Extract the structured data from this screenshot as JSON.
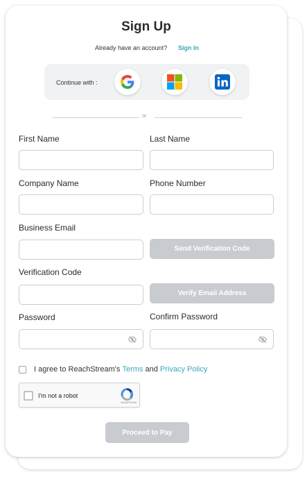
{
  "form": {
    "title": "Sign Up",
    "have_account_text": "Already have an account?",
    "sign_in_link": "Sign In",
    "continue_with_label": "Continue with :",
    "social": [
      "google-icon",
      "microsoft-icon",
      "linkedin-icon"
    ],
    "or_text": "or",
    "fields": {
      "first_name": {
        "label": "First Name",
        "value": "",
        "placeholder": ""
      },
      "last_name": {
        "label": "Last Name",
        "value": "",
        "placeholder": ""
      },
      "company_name": {
        "label": "Company Name",
        "value": "",
        "placeholder": ""
      },
      "phone_number": {
        "label": "Phone Number",
        "value": "",
        "placeholder": ""
      },
      "business_email": {
        "label": "Business Email",
        "value": "",
        "placeholder": ""
      },
      "verification_code": {
        "label": "Verification Code",
        "value": "",
        "placeholder": ""
      },
      "password": {
        "label": "Password",
        "value": "",
        "placeholder": ""
      },
      "confirm_password": {
        "label": "Confirm Password",
        "value": "",
        "placeholder": ""
      }
    },
    "send_code_button": "Send Verification Code",
    "verify_email_button": "Verify Email Address",
    "agree": {
      "prefix": "I agree to ReachStream's",
      "terms": "Terms",
      "and": "and",
      "privacy": "Privacy Policy",
      "checked": false
    },
    "captcha": {
      "label": "I'm not a robot",
      "brand": "reCAPTCHA"
    },
    "proceed_button": "Proceed to Pay"
  },
  "colors": {
    "accent": "#3aa7b8",
    "disabled_button": "#c8cbd0",
    "social_panel": "#f1f2f4"
  }
}
